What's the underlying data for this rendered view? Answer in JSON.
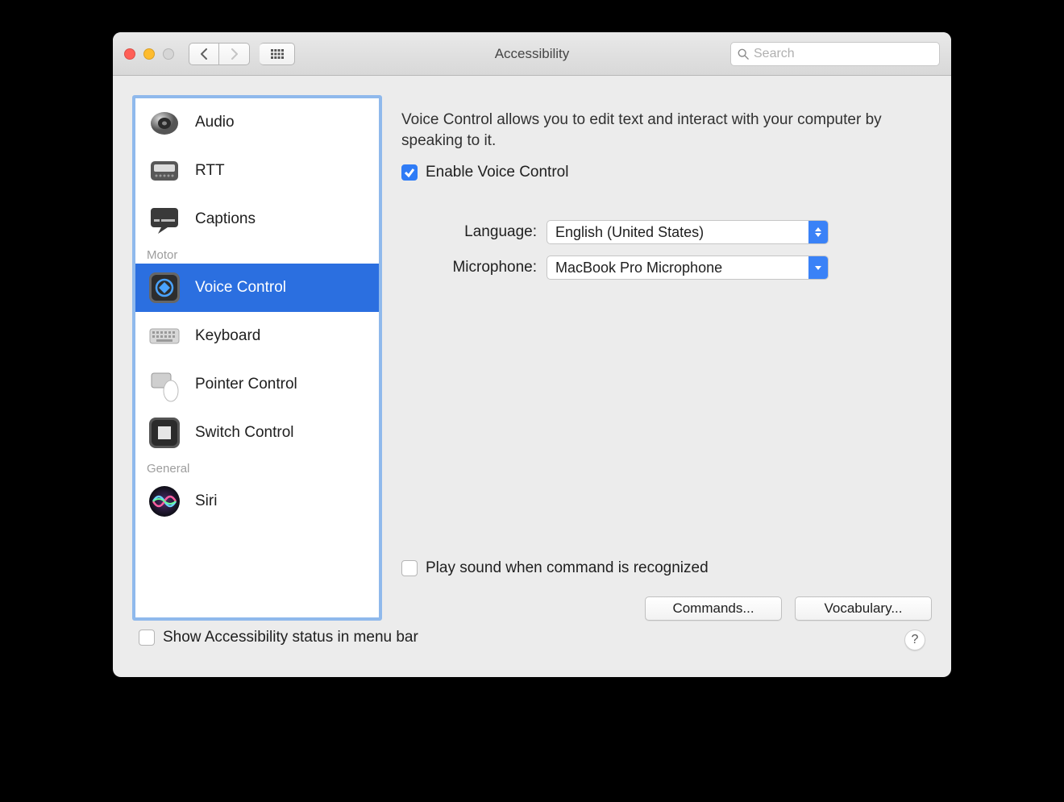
{
  "window": {
    "title": "Accessibility"
  },
  "search": {
    "placeholder": "Search"
  },
  "sidebar": {
    "sections": [
      {
        "label": "",
        "items": [
          {
            "id": "audio",
            "label": "Audio"
          },
          {
            "id": "rtt",
            "label": "RTT"
          },
          {
            "id": "captions",
            "label": "Captions"
          }
        ]
      },
      {
        "label": "Motor",
        "items": [
          {
            "id": "voice-control",
            "label": "Voice Control",
            "selected": true
          },
          {
            "id": "keyboard",
            "label": "Keyboard"
          },
          {
            "id": "pointer-control",
            "label": "Pointer Control"
          },
          {
            "id": "switch-control",
            "label": "Switch Control"
          }
        ]
      },
      {
        "label": "General",
        "items": [
          {
            "id": "siri",
            "label": "Siri"
          }
        ]
      }
    ]
  },
  "content": {
    "description": "Voice Control allows you to edit text and interact with your computer by speaking to it.",
    "enable_label": "Enable Voice Control",
    "enable_checked": true,
    "language_label": "Language:",
    "language_value": "English (United States)",
    "microphone_label": "Microphone:",
    "microphone_value": "MacBook Pro Microphone",
    "play_sound_label": "Play sound when command is recognized",
    "play_sound_checked": false,
    "commands_button": "Commands...",
    "vocabulary_button": "Vocabulary..."
  },
  "footer": {
    "menubar_label": "Show Accessibility status in menu bar",
    "menubar_checked": false
  }
}
